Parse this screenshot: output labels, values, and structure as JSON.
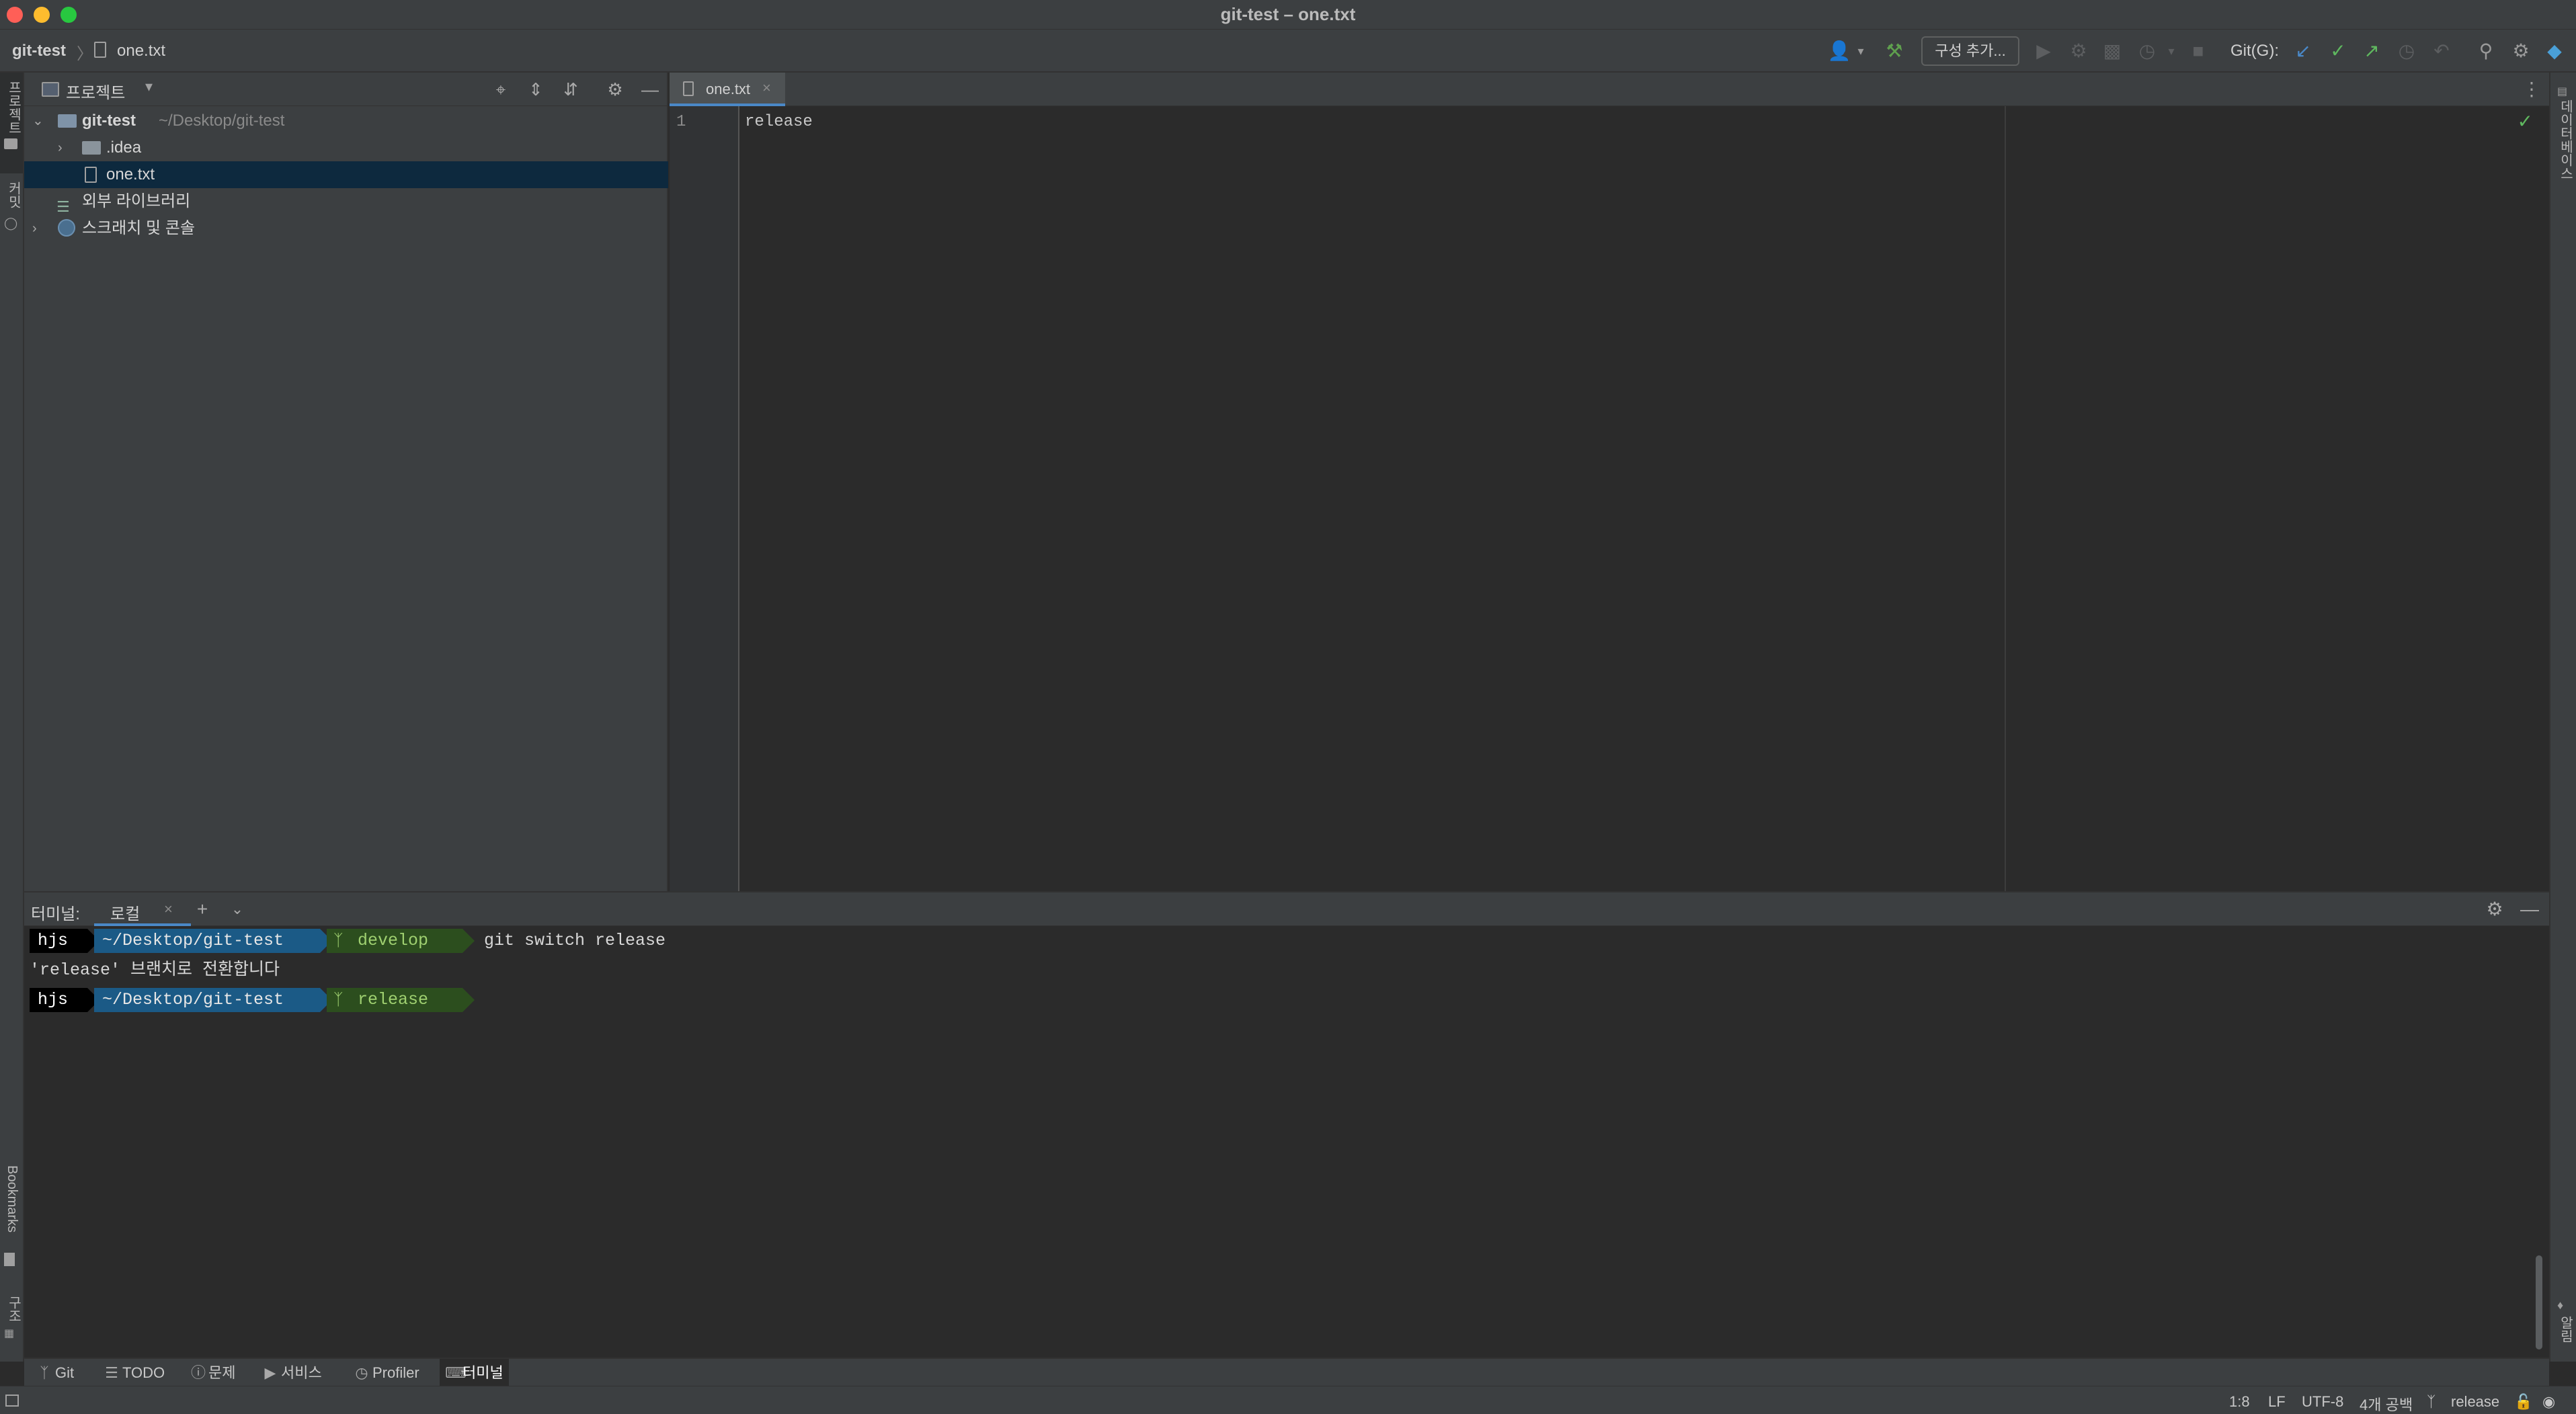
{
  "window": {
    "title": "git-test – one.txt"
  },
  "breadcrumb": {
    "project": "git-test",
    "separator": "〉",
    "file": "one.txt"
  },
  "toolbar": {
    "config_button": "구성 추가...",
    "git_label": "Git(G):",
    "icons": [
      "user-icon",
      "hammer-icon",
      "run-icon",
      "debug-icon",
      "coverage-icon",
      "profile-icon",
      "stop-icon",
      "git-update-icon",
      "git-commit-icon",
      "git-push-icon",
      "history-icon",
      "rollback-icon",
      "search-icon",
      "settings-icon",
      "toolbox-icon"
    ]
  },
  "left_stripe": {
    "project": "프로젝트",
    "commit": "커밋",
    "bookmarks": "Bookmarks",
    "structure": "구조"
  },
  "right_stripe": {
    "database": "데이터베이스",
    "notifications": "알림"
  },
  "project_panel": {
    "title": "프로젝트",
    "tree": [
      {
        "label": "git-test",
        "path": "~/Desktop/git-test",
        "type": "module",
        "expanded": true
      },
      {
        "label": ".idea",
        "type": "folder",
        "expanded": false
      },
      {
        "label": "one.txt",
        "type": "file",
        "selected": true
      },
      {
        "label": "외부 라이브러리",
        "type": "library"
      },
      {
        "label": "스크래치 및 콘솔",
        "type": "scratch",
        "expanded": false
      }
    ]
  },
  "editor": {
    "tab_label": "one.txt",
    "lines": [
      {
        "number": "1",
        "text": "release"
      }
    ]
  },
  "terminal": {
    "title": "터미널:",
    "tab_label": "로컬",
    "lines": [
      {
        "user": "hjs",
        "path": "~/Desktop/git-test",
        "branch": "develop",
        "command": "git switch release"
      },
      {
        "output": "'release' 브랜치로 전환합니다"
      },
      {
        "user": "hjs",
        "path": "~/Desktop/git-test",
        "branch": "release",
        "command": ""
      }
    ]
  },
  "bottom_tools": [
    {
      "label": "Git",
      "icon": "branch-icon"
    },
    {
      "label": "TODO",
      "icon": "list-icon"
    },
    {
      "label": "문제",
      "icon": "problems-icon"
    },
    {
      "label": "서비스",
      "icon": "services-icon"
    },
    {
      "label": "Profiler",
      "icon": "profiler-icon"
    },
    {
      "label": "터미널",
      "icon": "terminal-icon",
      "active": true
    }
  ],
  "statusbar": {
    "position": "1:8",
    "line_separator": "LF",
    "encoding": "UTF-8",
    "indent": "4개 공백",
    "branch": "release"
  },
  "colors": {
    "accent": "#4a88c7",
    "prompt_user_bg": "#000000",
    "prompt_path_bg": "#1b5a86",
    "prompt_branch_bg": "#2c4e1e",
    "selection": "#0d293e"
  }
}
